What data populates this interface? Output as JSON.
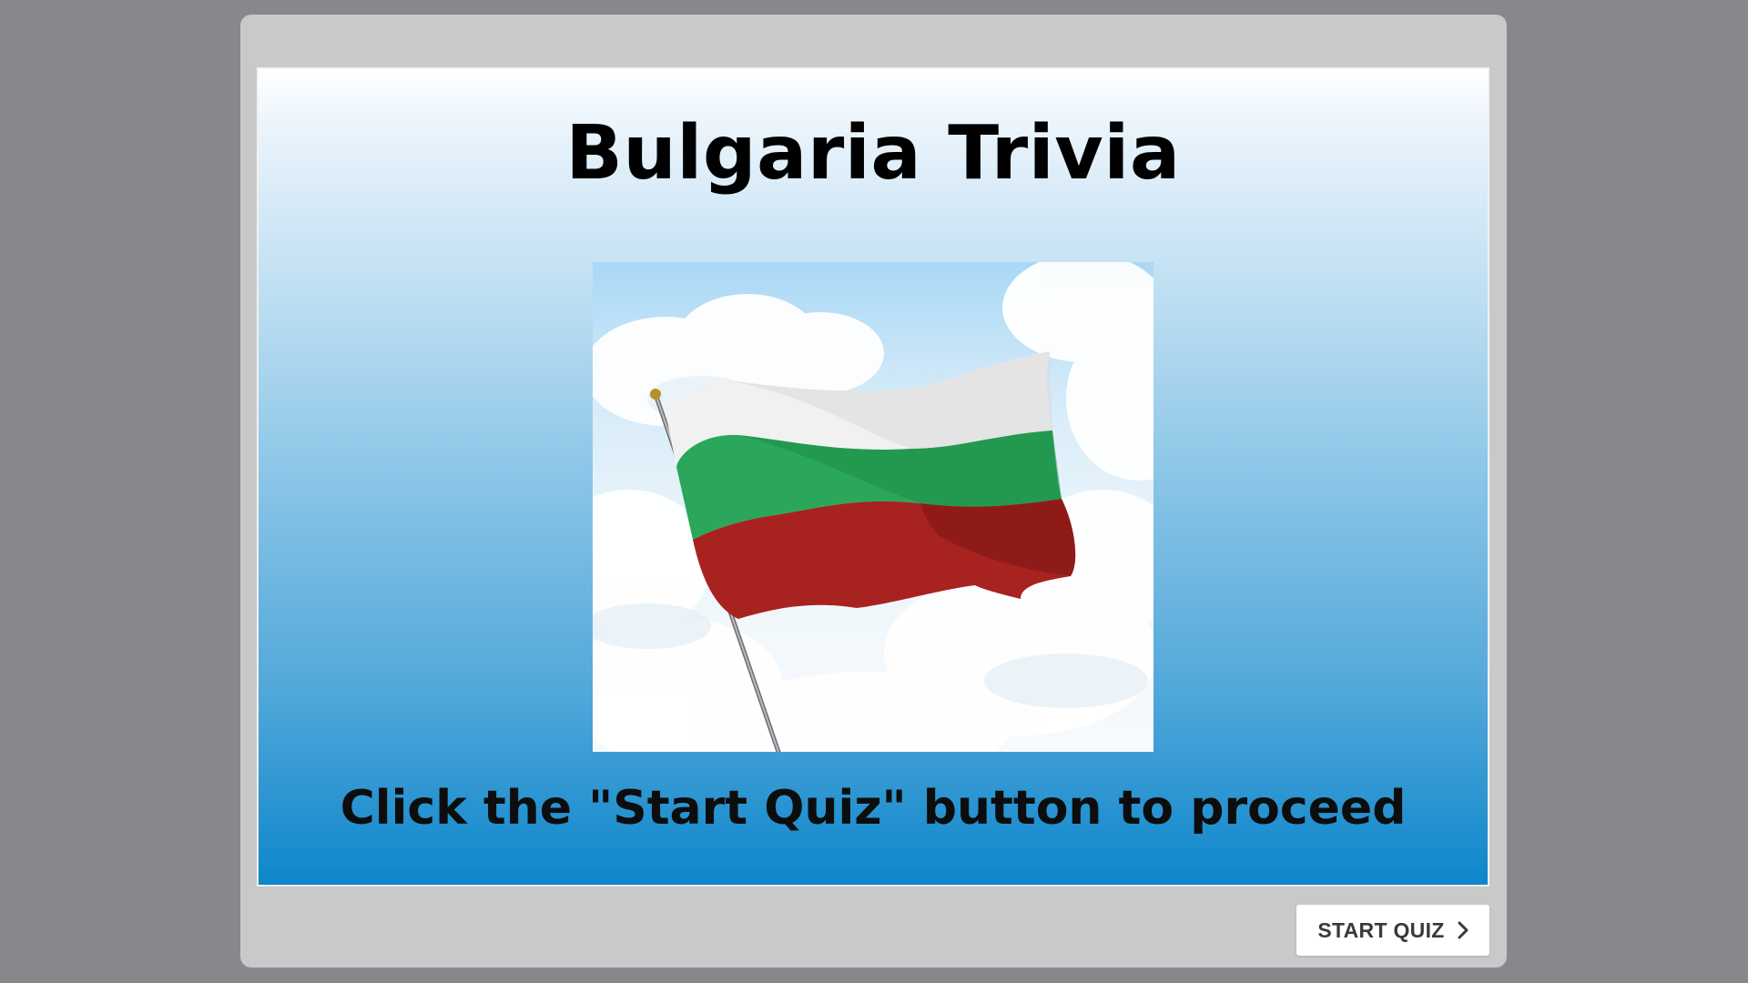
{
  "slide": {
    "title": "Bulgaria Trivia",
    "instruction": "Click the \"Start Quiz\" button to proceed",
    "image": {
      "subject": "bulgarian-flag-waving",
      "colors": {
        "white": "#f1f1f1",
        "green": "#2aa75a",
        "red": "#a8221f",
        "sky": "#a9d8f6"
      }
    }
  },
  "controls": {
    "start_button_label": "START QUIZ",
    "start_button_icon": "chevron-right-icon"
  },
  "colors": {
    "background": "#86888b",
    "player_frame": "#c9c9c9",
    "gradient_top": "#ffffff",
    "gradient_bottom": "#0e86cb"
  }
}
